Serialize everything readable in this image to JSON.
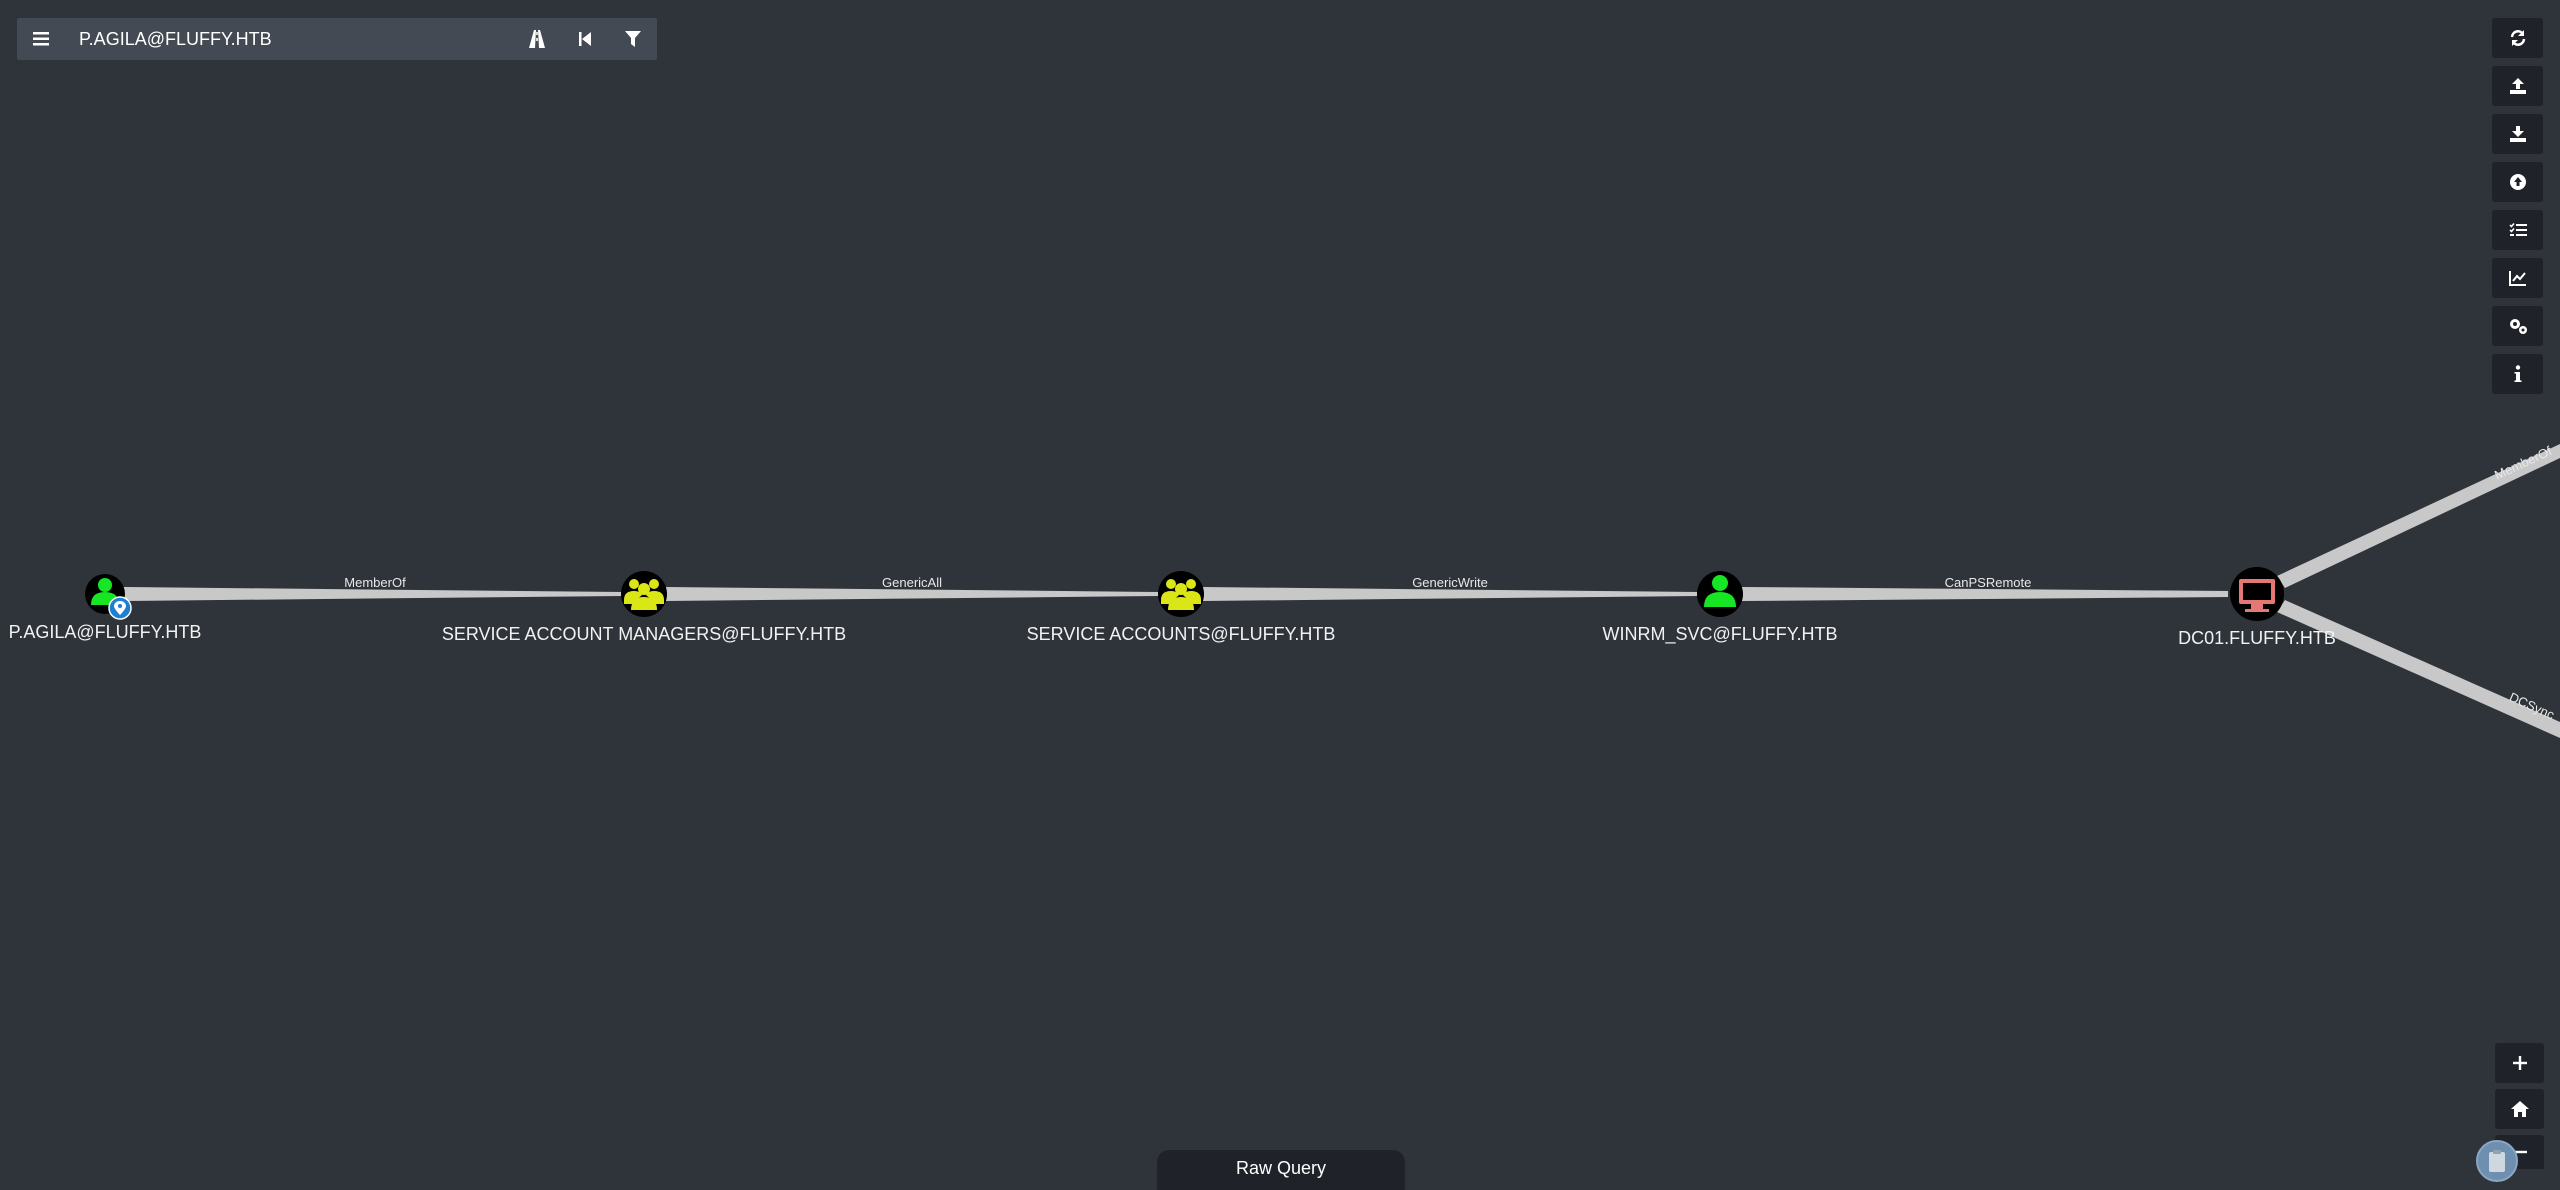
{
  "search": {
    "value": "P.AGILA@FLUFFY.HTB",
    "buttons": [
      {
        "name": "pathfinding-icon"
      },
      {
        "name": "back-icon"
      },
      {
        "name": "filter-icon"
      }
    ]
  },
  "right_toolbar": [
    {
      "name": "refresh-icon"
    },
    {
      "name": "upload-icon"
    },
    {
      "name": "download-icon"
    },
    {
      "name": "import-icon"
    },
    {
      "name": "queries-list-icon"
    },
    {
      "name": "chart-icon"
    },
    {
      "name": "settings-icon"
    },
    {
      "name": "info-icon"
    }
  ],
  "graph": {
    "nodes": [
      {
        "id": "p_agila",
        "label": "P.AGILA@FLUFFY.HTB",
        "type": "user",
        "color": "#17e625",
        "owned_marker": true
      },
      {
        "id": "sam",
        "label": "SERVICE ACCOUNT MANAGERS@FLUFFY.HTB",
        "type": "group",
        "color": "#dbe617"
      },
      {
        "id": "sa",
        "label": "SERVICE ACCOUNTS@FLUFFY.HTB",
        "type": "group",
        "color": "#dbe617"
      },
      {
        "id": "winrm",
        "label": "WINRM_SVC@FLUFFY.HTB",
        "type": "user",
        "color": "#17e625"
      },
      {
        "id": "dc01",
        "label": "DC01.FLUFFY.HTB",
        "type": "computer",
        "color": "#e67873"
      }
    ],
    "edges": [
      {
        "from": "p_agila",
        "to": "sam",
        "label": "MemberOf"
      },
      {
        "from": "sam",
        "to": "sa",
        "label": "GenericAll"
      },
      {
        "from": "sa",
        "to": "winrm",
        "label": "GenericWrite"
      },
      {
        "from": "winrm",
        "to": "dc01",
        "label": "CanPSRemote"
      },
      {
        "from": "dc01",
        "to": "offscreen_up",
        "label": "MemberOf"
      },
      {
        "from": "dc01",
        "to": "offscreen_down",
        "label": "DCSync"
      }
    ]
  },
  "zoom": {
    "plus_label": "+",
    "minus_label": "−"
  },
  "raw_query": {
    "label": "Raw Query"
  },
  "colors": {
    "background": "#2f343b",
    "edge": "#c8c8c8",
    "panel": "#1f2329",
    "search_bar": "#444a53"
  }
}
